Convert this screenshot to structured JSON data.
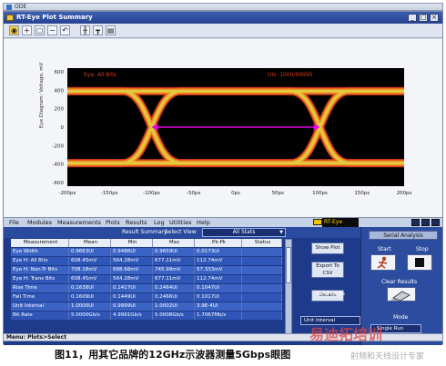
{
  "os_window": {
    "title": "ODE"
  },
  "app": {
    "title": "RT-Eye Plot Summary",
    "window_buttons": [
      "_",
      "□",
      "×"
    ],
    "toolbar_icons": [
      "eye-icon",
      "zoom-in-icon",
      "zoom-box-icon",
      "zoom-out-icon",
      "undo-zoom-icon",
      "cursor-icon",
      "marker-icon",
      "save-icon"
    ]
  },
  "plot": {
    "legend_left": "Eye: All Bits",
    "legend_right": "UIs: 1000/99995",
    "ylabel": "Eye Diagram: Voltage, mV",
    "colors": {
      "background": "#000000",
      "trace": "#e4c840",
      "edge": "#d63a1a",
      "marker": "#e100e1"
    }
  },
  "chart_data": {
    "type": "eye-diagram",
    "xlabel": "",
    "ylabel": "Eye Diagram: Voltage, mV",
    "x_ticks": [
      "-200ps",
      "-150ps",
      "-100ps",
      "-50ps",
      "0ps",
      "50ps",
      "100ps",
      "150ps",
      "200ps"
    ],
    "y_ticks": [
      "600",
      "400",
      "200",
      "0",
      "-200",
      "-400",
      "-600"
    ],
    "xlim": [
      -200,
      200
    ],
    "ylim": [
      -640,
      640
    ],
    "high_level_mV": 390,
    "low_level_mV": -390,
    "crossings_ps": [
      -100,
      100
    ],
    "eye_width_ps": 200,
    "grid": false
  },
  "menubar": {
    "items": [
      "File",
      "Modules",
      "Measurements",
      "Plots",
      "Results",
      "Log",
      "Utilities",
      "Help"
    ],
    "brand": "RT-Eye"
  },
  "results": {
    "summary_label": "Result Summary",
    "select_view_label": "Select View",
    "select_view_value": "All Stats",
    "columns": [
      "Measurement",
      "Mean",
      "Min",
      "Max",
      "Pk-Pk",
      "Status"
    ],
    "rows": [
      [
        "Eye Width",
        "0.9663UI",
        "0.9486UI",
        "0.9659UI",
        "0.0173UI",
        ""
      ],
      [
        "Eye H: All Bits",
        "608.45mV",
        "564.28mV",
        "677.11mV",
        "112.74mV",
        ""
      ],
      [
        "Eye H: Non-Tr Bits",
        "708.18mV",
        "688.68mV",
        "745.99mV",
        "57.333mV",
        ""
      ],
      [
        "Eye H: Trans Bits",
        "608.45mV",
        "564.28mV",
        "677.11mV",
        "112.74mV",
        ""
      ],
      [
        "Rise Time",
        "0.1638UI",
        "0.1417UI",
        "0.2464UI",
        "0.1047UI",
        ""
      ],
      [
        "Fall Time",
        "0.1609UI",
        "0.1449UI",
        "0.2466UI",
        "0.1017UI",
        ""
      ],
      [
        "Unit Interval",
        "1.0000UI",
        "0.9999UI",
        "1.0002UI",
        "3.9E-4UI",
        ""
      ],
      [
        "Bit Rate",
        "5.0000Gb/s",
        "4.9991Gb/s",
        "5.0008Gb/s",
        "1.7067Mb/s",
        ""
      ]
    ],
    "buttons": {
      "show_plot": "Show Plot",
      "export": "Export To CSV",
      "details": "Details"
    },
    "time_units_label": "Time Units",
    "time_units_value": "Unit Interval"
  },
  "serial_panel": {
    "header": "Serial Analysis",
    "start_label": "Start",
    "stop_label": "Stop",
    "clear_label": "Clear Results",
    "mode_label": "Mode",
    "mode_value": "Single Run"
  },
  "status_bar": {
    "text": "Menu: Plots>Select"
  },
  "caption": "图11，用其它品牌的12GHz示波器测量5Gbps眼图",
  "watermark": {
    "line1": "易迪拓培训",
    "line2": "射频和天线设计专家"
  }
}
